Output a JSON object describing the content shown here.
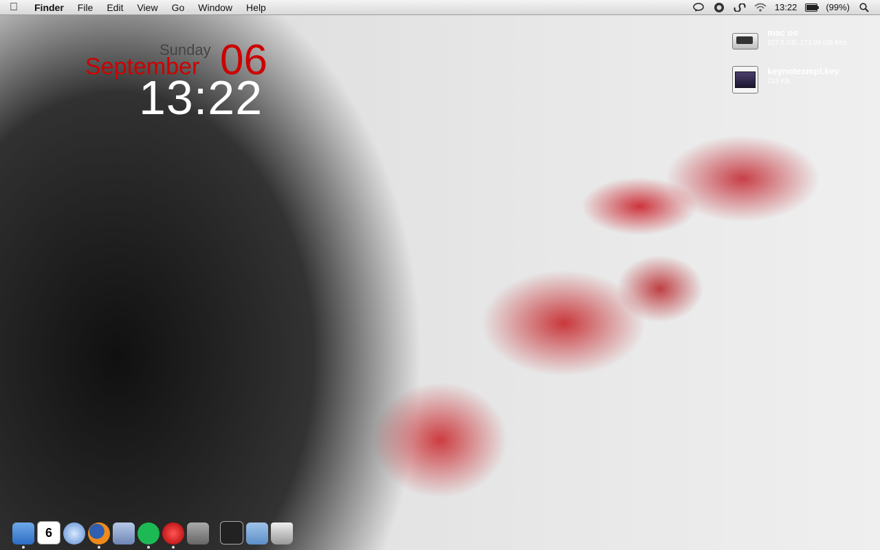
{
  "menubar": {
    "app_name": "Finder",
    "items": [
      "File",
      "Edit",
      "View",
      "Go",
      "Window",
      "Help"
    ],
    "clock": "13:22",
    "battery_text": "(99%)"
  },
  "clock_widget": {
    "day": "Sunday",
    "month": "September",
    "date": "06",
    "time": "13:22"
  },
  "desktop_items": [
    {
      "name": "mac os",
      "meta": "227.5 GB, 173.09 GB free",
      "icon": "hard-drive-icon"
    },
    {
      "name": "keynotexmpl.key",
      "meta": "213 KB",
      "icon": "keynote-file-icon"
    }
  ],
  "dock": [
    {
      "name": "finder",
      "icon": "finder-icon",
      "running": true
    },
    {
      "name": "ical",
      "icon": "calendar-icon",
      "date": "6",
      "running": false
    },
    {
      "name": "itunes",
      "icon": "itunes-icon",
      "running": false
    },
    {
      "name": "firefox",
      "icon": "firefox-icon",
      "running": true
    },
    {
      "name": "mail",
      "icon": "mail-icon",
      "running": false
    },
    {
      "name": "spotify",
      "icon": "spotify-icon",
      "running": true
    },
    {
      "name": "adium",
      "icon": "adium-icon",
      "running": true
    },
    {
      "name": "system-preferences",
      "icon": "gear-icon",
      "running": false
    },
    {
      "name": "activity-monitor",
      "icon": "activity-monitor-icon",
      "running": false
    },
    {
      "name": "documents",
      "icon": "folder-icon",
      "running": false
    },
    {
      "name": "trash",
      "icon": "trash-icon",
      "running": false
    }
  ]
}
